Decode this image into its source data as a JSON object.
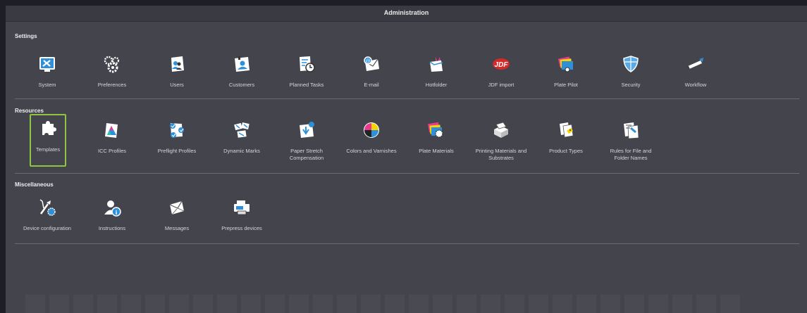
{
  "window": {
    "title": "Administration"
  },
  "sections": {
    "settings": {
      "title": "Settings",
      "items": [
        {
          "label": "System",
          "icon": "system-icon"
        },
        {
          "label": "Preferences",
          "icon": "gears-icon"
        },
        {
          "label": "Users",
          "icon": "users-icon"
        },
        {
          "label": "Customers",
          "icon": "customers-icon"
        },
        {
          "label": "Planned Tasks",
          "icon": "clock-icon"
        },
        {
          "label": "E-mail",
          "icon": "email-icon"
        },
        {
          "label": "Hotfolder",
          "icon": "hotfolder-icon"
        },
        {
          "label": "JDF import",
          "icon": "jdf-icon"
        },
        {
          "label": "Plate Pilot",
          "icon": "plate-pilot-icon"
        },
        {
          "label": "Security",
          "icon": "shield-icon"
        },
        {
          "label": "Workflow",
          "icon": "workflow-icon"
        }
      ]
    },
    "resources": {
      "title": "Resources",
      "items": [
        {
          "label": "Templates",
          "icon": "puzzle-icon"
        },
        {
          "label": "ICC Profiles",
          "icon": "icc-icon"
        },
        {
          "label": "Preflight Profiles",
          "icon": "preflight-icon"
        },
        {
          "label": "Dynamic Marks",
          "icon": "marks-icon"
        },
        {
          "label": "Paper Stretch Compensation",
          "icon": "paper-stretch-icon"
        },
        {
          "label": "Colors and Varnishes",
          "icon": "color-wheel-icon"
        },
        {
          "label": "Plate Materials",
          "icon": "plate-materials-icon"
        },
        {
          "label": "Printing Materials and Substrates",
          "icon": "substrates-icon"
        },
        {
          "label": "Product Types",
          "icon": "product-types-icon"
        },
        {
          "label": "Rules for File and Folder Names",
          "icon": "rules-icon"
        }
      ]
    },
    "misc": {
      "title": "Miscellaneous",
      "items": [
        {
          "label": "Device configuration",
          "icon": "device-config-icon"
        },
        {
          "label": "Instructions",
          "icon": "instructions-icon"
        },
        {
          "label": "Messages",
          "icon": "messages-icon"
        },
        {
          "label": "Prepress devices",
          "icon": "prepress-device-icon"
        }
      ]
    }
  },
  "selected_item": "Templates",
  "colors": {
    "selection": "#8ec63f",
    "accent_blue": "#3a8fd6"
  }
}
